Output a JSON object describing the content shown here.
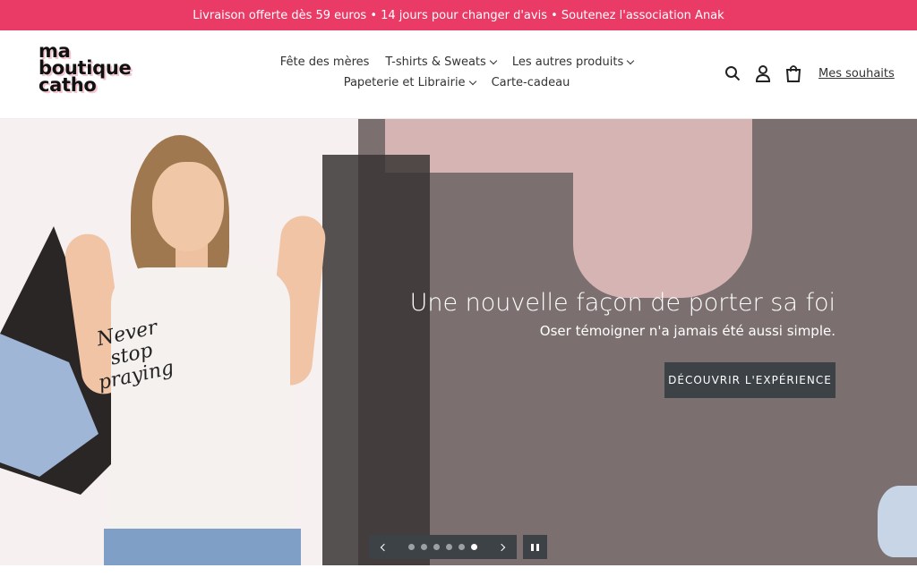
{
  "announcement": {
    "text": "Livraison offerte dès 59 euros • 14 jours pour changer d'avis • Soutenez l'association Anak"
  },
  "logo": {
    "line1": "ma",
    "line2": "boutique",
    "line3": "catho"
  },
  "nav": {
    "row1": [
      {
        "label": "Fête des mères",
        "dropdown": false
      },
      {
        "label": "T-shirts & Sweats",
        "dropdown": true
      },
      {
        "label": "Les autres produits",
        "dropdown": true
      }
    ],
    "row2": [
      {
        "label": "Papeterie et Librairie",
        "dropdown": true
      },
      {
        "label": "Carte-cadeau",
        "dropdown": false
      }
    ]
  },
  "header_icons": {
    "search": "search-icon",
    "account": "user-icon",
    "cart": "shopping-bag-icon"
  },
  "wishlist": {
    "label": "Mes souhaits"
  },
  "hero": {
    "title": "Une nouvelle façon de porter sa foi",
    "subtitle": "Oser témoigner n'a jamais été aussi simple.",
    "button": "DÉCOUVRIR L'EXPÉRIENCE",
    "shirt_text": "Never stop praying"
  },
  "slider": {
    "slides": 6,
    "active_index": 5
  },
  "colors": {
    "announcement_bg": "#ea3a66",
    "button_bg": "#3d4246"
  }
}
